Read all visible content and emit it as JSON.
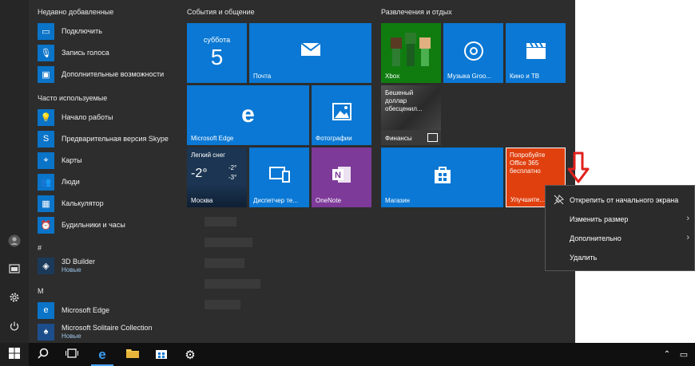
{
  "sections": {
    "recent": "Недавно добавленные",
    "frequent": "Часто используемые",
    "hash": "#",
    "m": "M"
  },
  "recent_apps": [
    {
      "label": "Подключить",
      "icon": "connect-icon"
    },
    {
      "label": "Запись голоса",
      "icon": "microphone-icon"
    },
    {
      "label": "Дополнительные возможности",
      "icon": "extras-icon"
    }
  ],
  "frequent_apps": [
    {
      "label": "Начало работы",
      "icon": "lightbulb-icon"
    },
    {
      "label": "Предварительная версия Skype",
      "icon": "skype-icon"
    },
    {
      "label": "Карты",
      "icon": "maps-icon"
    },
    {
      "label": "Люди",
      "icon": "people-icon"
    },
    {
      "label": "Калькулятор",
      "icon": "calculator-icon"
    },
    {
      "label": "Будильники и часы",
      "icon": "alarm-icon"
    }
  ],
  "hash_apps": [
    {
      "label": "3D Builder",
      "sub": "Новые",
      "icon": "3d-builder-icon"
    }
  ],
  "m_apps": [
    {
      "label": "Microsoft Edge",
      "icon": "edge-icon"
    },
    {
      "label": "Microsoft Solitaire Collection",
      "sub": "Новые",
      "icon": "solitaire-icon"
    }
  ],
  "groups": {
    "events": "События и общение",
    "entertainment": "Развлечения и отдых"
  },
  "tiles": {
    "calendar_day": "суббота",
    "calendar_num": "5",
    "mail": "Почта",
    "edge": "Microsoft Edge",
    "photos": "Фотографии",
    "weather_title": "Легкий снег",
    "weather_temp": "-2°",
    "weather_hi": "-2°",
    "weather_lo": "-3°",
    "weather_city": "Москва",
    "phone": "Диспетчер те...",
    "onenote": "OneNote",
    "xbox": "Xbox",
    "groove": "Музыка Groo...",
    "movies": "Кино и ТВ",
    "finance_news": "Бешеный доллар обесценил...",
    "finance": "Финансы",
    "store": "Магазин",
    "office_promo": "Попробуйте Office 365 бесплатно",
    "office": "Улучшите..."
  },
  "context_menu": [
    {
      "label": "Открепить от начального экрана",
      "icon": "unpin-icon",
      "submenu": false
    },
    {
      "label": "Изменить размер",
      "submenu": true
    },
    {
      "label": "Дополнительно",
      "submenu": true
    },
    {
      "label": "Удалить",
      "submenu": false
    }
  ],
  "colors": {
    "accent": "#0a78d4",
    "office": "#e0400e",
    "onenote": "#7d3a99",
    "xbox": "#107c10",
    "arrow": "#e0201b"
  }
}
